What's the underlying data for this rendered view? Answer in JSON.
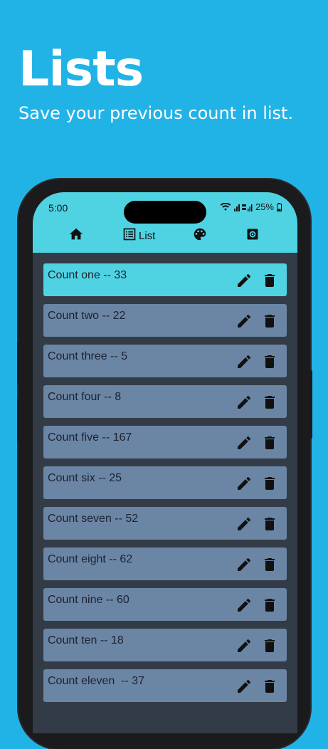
{
  "hero": {
    "title": "Lists",
    "subtitle": "Save your previous count in list."
  },
  "status_bar": {
    "time": "5:00",
    "battery": "25%"
  },
  "nav": {
    "active_label": "List"
  },
  "colors": {
    "background": "#22b3e6",
    "header": "#4fd3e3",
    "screen": "#333b46",
    "item": "#6b85a5",
    "item_active": "#4fd3e3"
  },
  "counts": [
    {
      "label": "Count one -- 33"
    },
    {
      "label": "Count two -- 22"
    },
    {
      "label": "Count three -- 5"
    },
    {
      "label": "Count four -- 8"
    },
    {
      "label": "Count five -- 167"
    },
    {
      "label": "Count six -- 25"
    },
    {
      "label": "Count seven -- 52"
    },
    {
      "label": "Count eight -- 62"
    },
    {
      "label": "Count nine -- 60"
    },
    {
      "label": "Count ten -- 18"
    },
    {
      "label": "Count eleven  -- 37"
    }
  ]
}
